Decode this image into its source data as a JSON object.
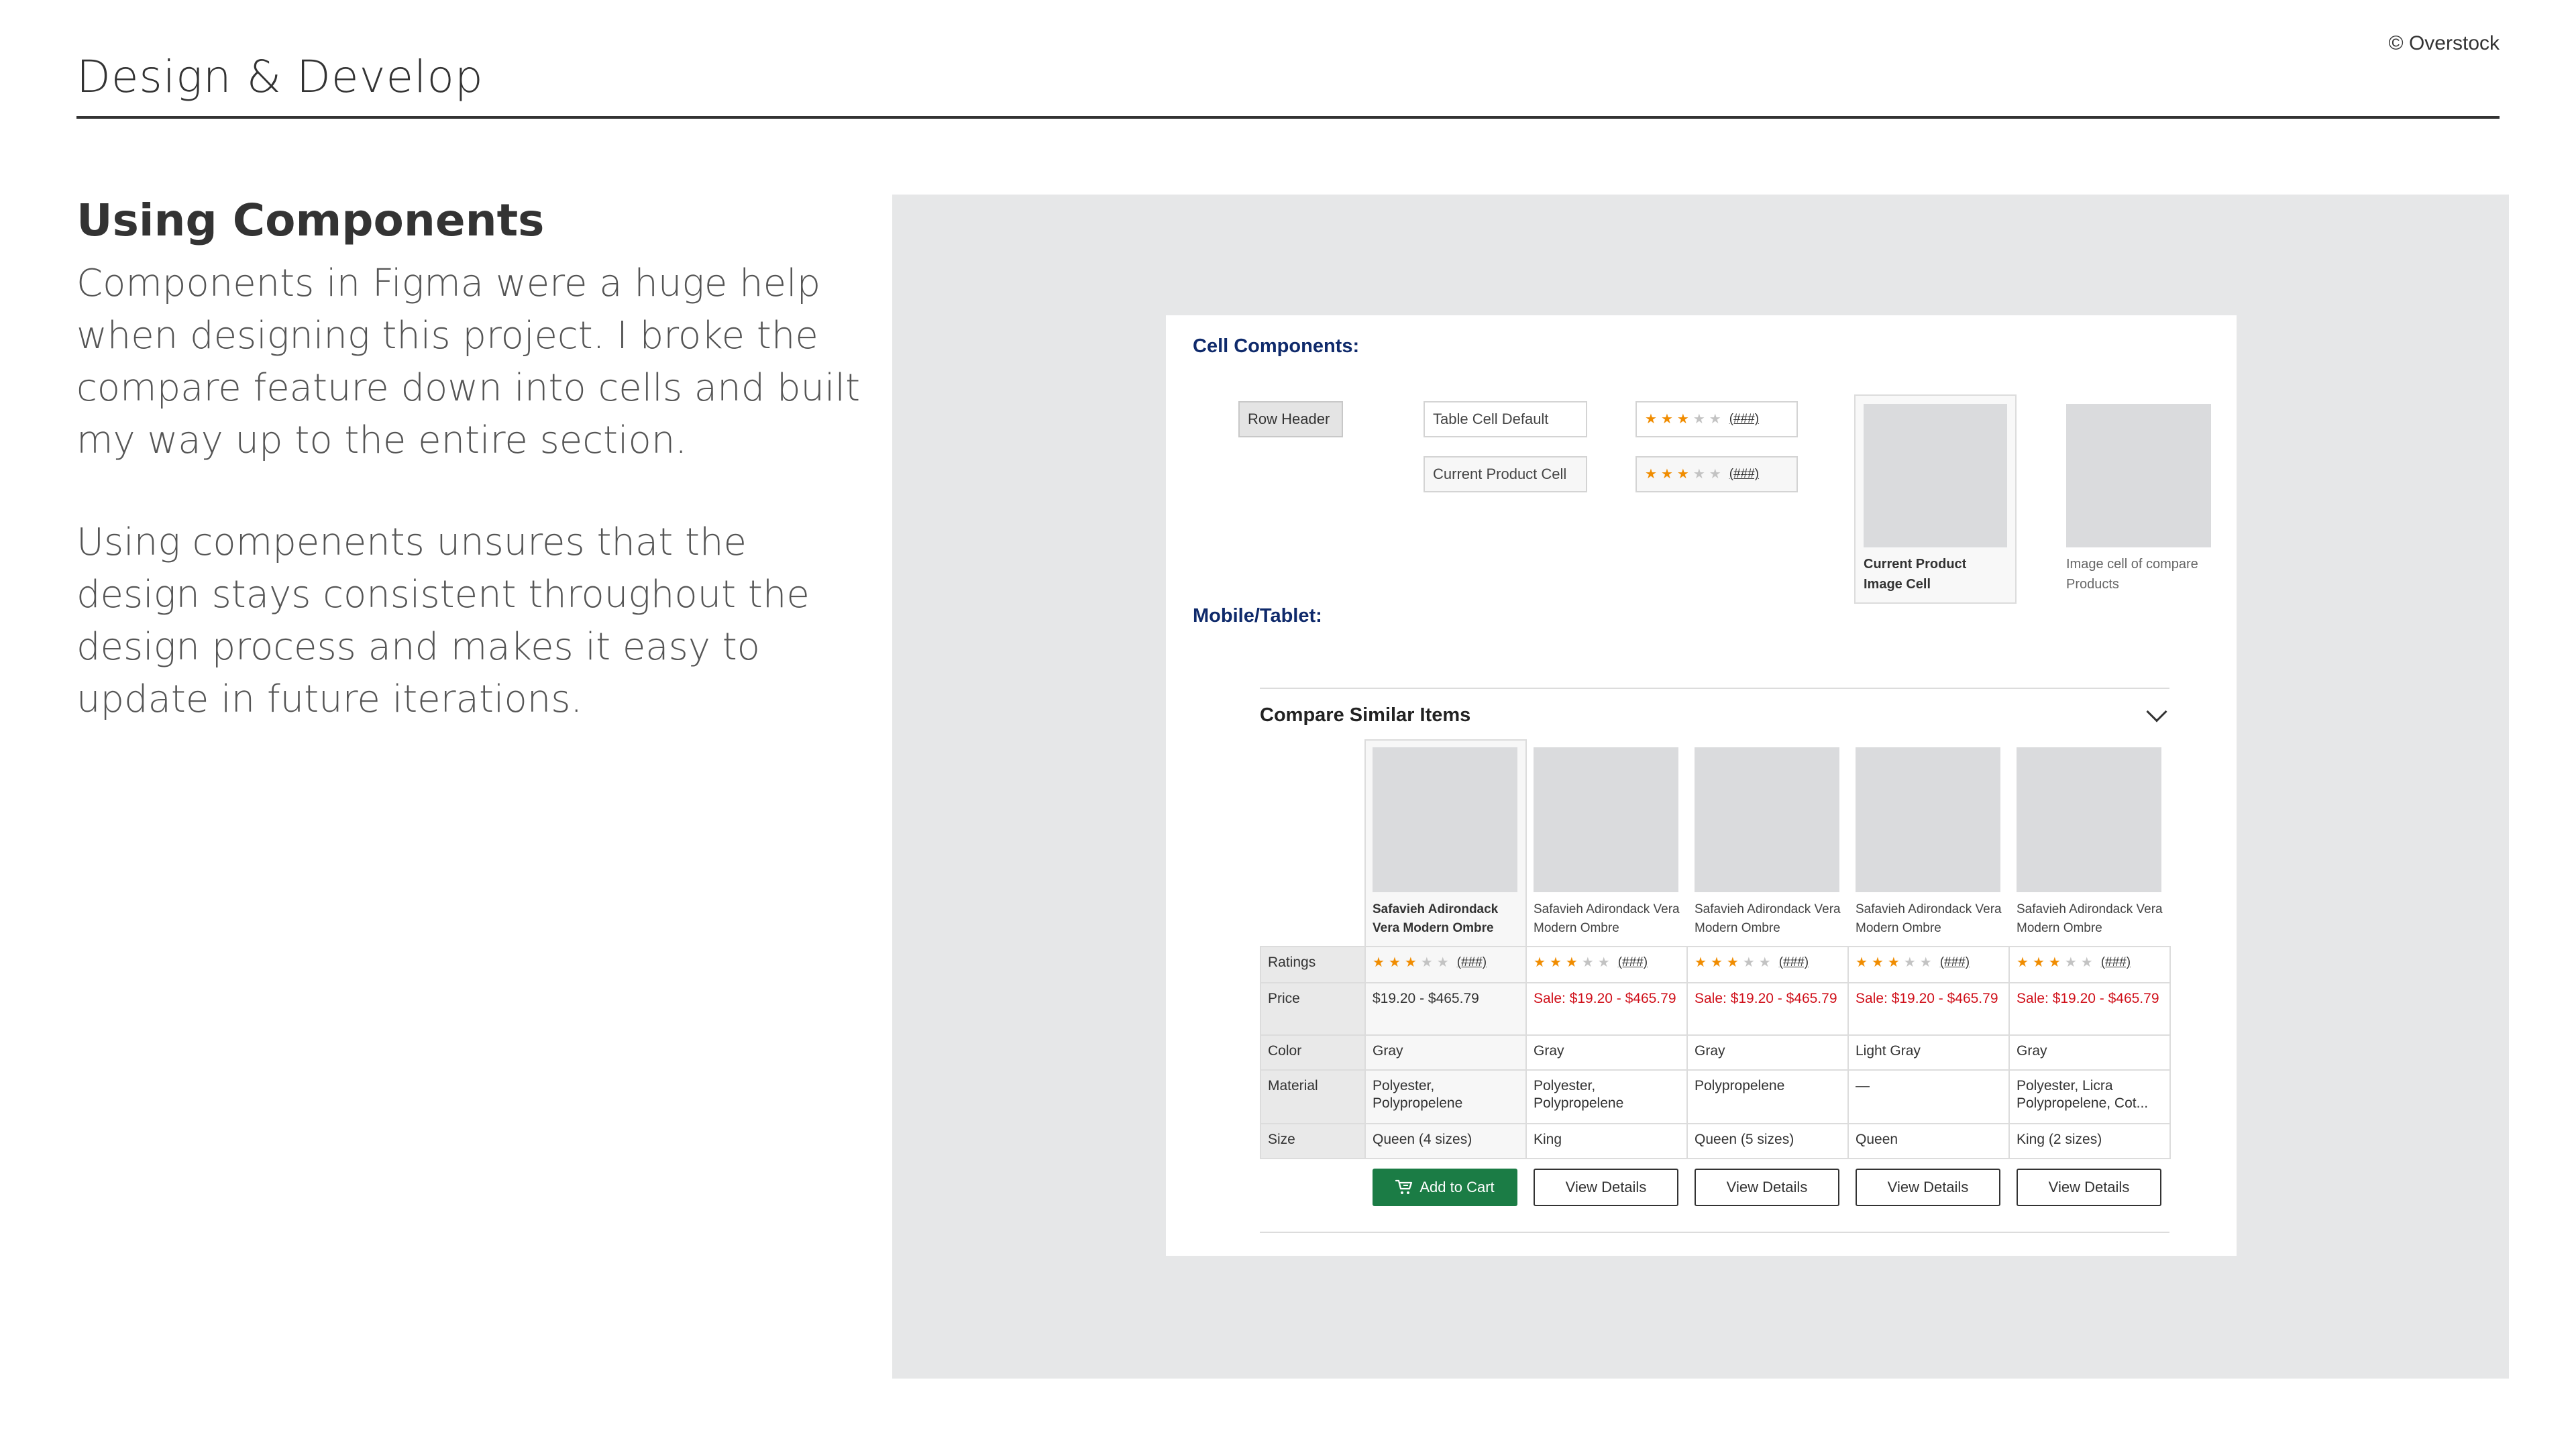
{
  "header": {
    "title": "Design & Develop",
    "copyright": "© Overstock"
  },
  "content": {
    "heading": "Using Components",
    "paragraph1": "Components in Figma were a huge help when designing this project. I broke the compare feature down into cells and built my way up to the entire section.",
    "paragraph2": "Using compenents unsures that the design stays consistent throughout the design process and makes it easy to update in future iterations."
  },
  "cells": {
    "label": "Cell Components:",
    "row_header": "Row Header",
    "table_cell_default": "Table Cell Default",
    "current_product_cell": "Current Product Cell",
    "rating_count": "(###)",
    "current_image_caption": "Current Product Image Cell",
    "compare_image_caption": "Image cell of compare Products"
  },
  "mobile": {
    "label": "Mobile/Tablet:",
    "compare_title": "Compare Similar Items",
    "rating_count": "(###)",
    "rating_filled_stars": 3,
    "products": [
      {
        "name": "Safavieh Adirondack Vera Modern Ombre",
        "current": true
      },
      {
        "name": "Safavieh Adirondack Vera Modern Ombre",
        "current": false
      },
      {
        "name": "Safavieh Adirondack Vera Modern Ombre",
        "current": false
      },
      {
        "name": "Safavieh Adirondack Vera Modern Ombre",
        "current": false
      },
      {
        "name": "Safavieh Adirondack Vera Modern Ombre",
        "current": false
      }
    ],
    "row_headers": {
      "ratings": "Ratings",
      "price": "Price",
      "color": "Color",
      "material": "Material",
      "size": "Size"
    },
    "prices": [
      "$19.20 - $465.79",
      "Sale: $19.20 - $465.79",
      "Sale: $19.20 - $465.79",
      "Sale: $19.20 - $465.79",
      "Sale: $19.20 - $465.79"
    ],
    "colors": [
      "Gray",
      "Gray",
      "Gray",
      "Light Gray",
      "Gray"
    ],
    "materials": [
      "Polyester, Polypropelene",
      "Polyester, Polypropelene",
      "Polypropelene",
      "—",
      "Polyester, Licra Polypropelene, Cot..."
    ],
    "sizes": [
      "Queen (4 sizes)",
      "King",
      "Queen (5 sizes)",
      "Queen",
      "King (2 sizes)"
    ],
    "add_to_cart": "Add to Cart",
    "view_details": "View Details"
  },
  "colors": {
    "accent_green": "#1b7c45",
    "sale_red": "#d0111b",
    "label_navy": "#0f2a6b",
    "star_orange": "#f08c00"
  }
}
